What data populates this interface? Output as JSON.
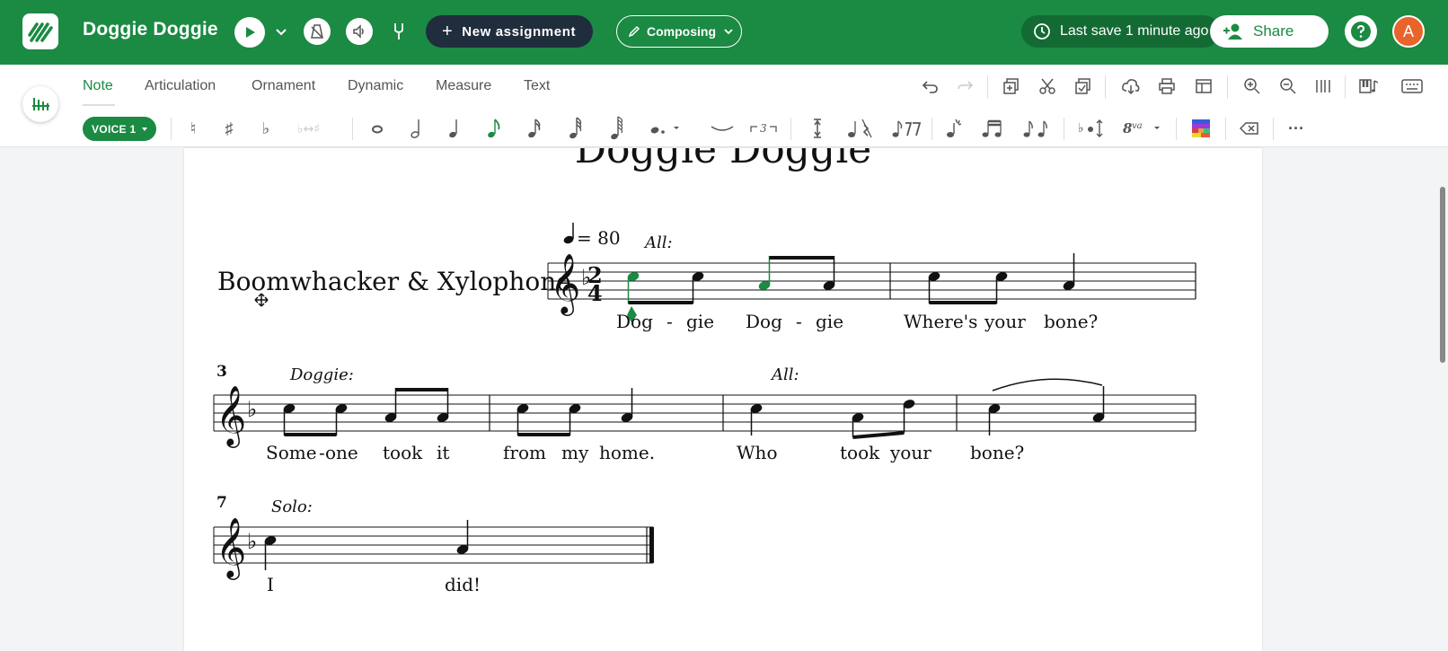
{
  "topbar": {
    "title": "Doggie Doggie",
    "new_assignment_label": "New assignment",
    "mode_label": "Composing",
    "last_save": "Last save 1 minute ago",
    "share_label": "Share",
    "avatar_initial": "A",
    "brand_color": "#1b8a43"
  },
  "ribbon": {
    "tabs": [
      "Note",
      "Articulation",
      "Ornament",
      "Dynamic",
      "Measure",
      "Text"
    ],
    "active_tab": "Note",
    "voice_label": "VOICE 1",
    "natural": "♮",
    "sharp": "♯",
    "flat": "♭",
    "more": "···"
  },
  "score": {
    "title": "Doggie Doggie",
    "instrument": "Boomwhacker & Xylophone",
    "tempo": "= 80",
    "measure_numbers": [
      "3",
      "7"
    ],
    "directions": [
      "All:",
      "Doggie:",
      "All:",
      "Solo:"
    ],
    "time_sig": [
      "2",
      "4"
    ],
    "lyrics_line1": [
      "Dog",
      "-",
      "gie",
      "Dog",
      "-",
      "gie",
      "Where's",
      "your",
      "bone?"
    ],
    "lyrics_line2": [
      "Some",
      "-",
      "one",
      "took",
      "it",
      "from",
      "my",
      "home.",
      "Who",
      "took",
      "your",
      "bone?"
    ],
    "lyrics_line3": [
      "I",
      "did!"
    ]
  }
}
